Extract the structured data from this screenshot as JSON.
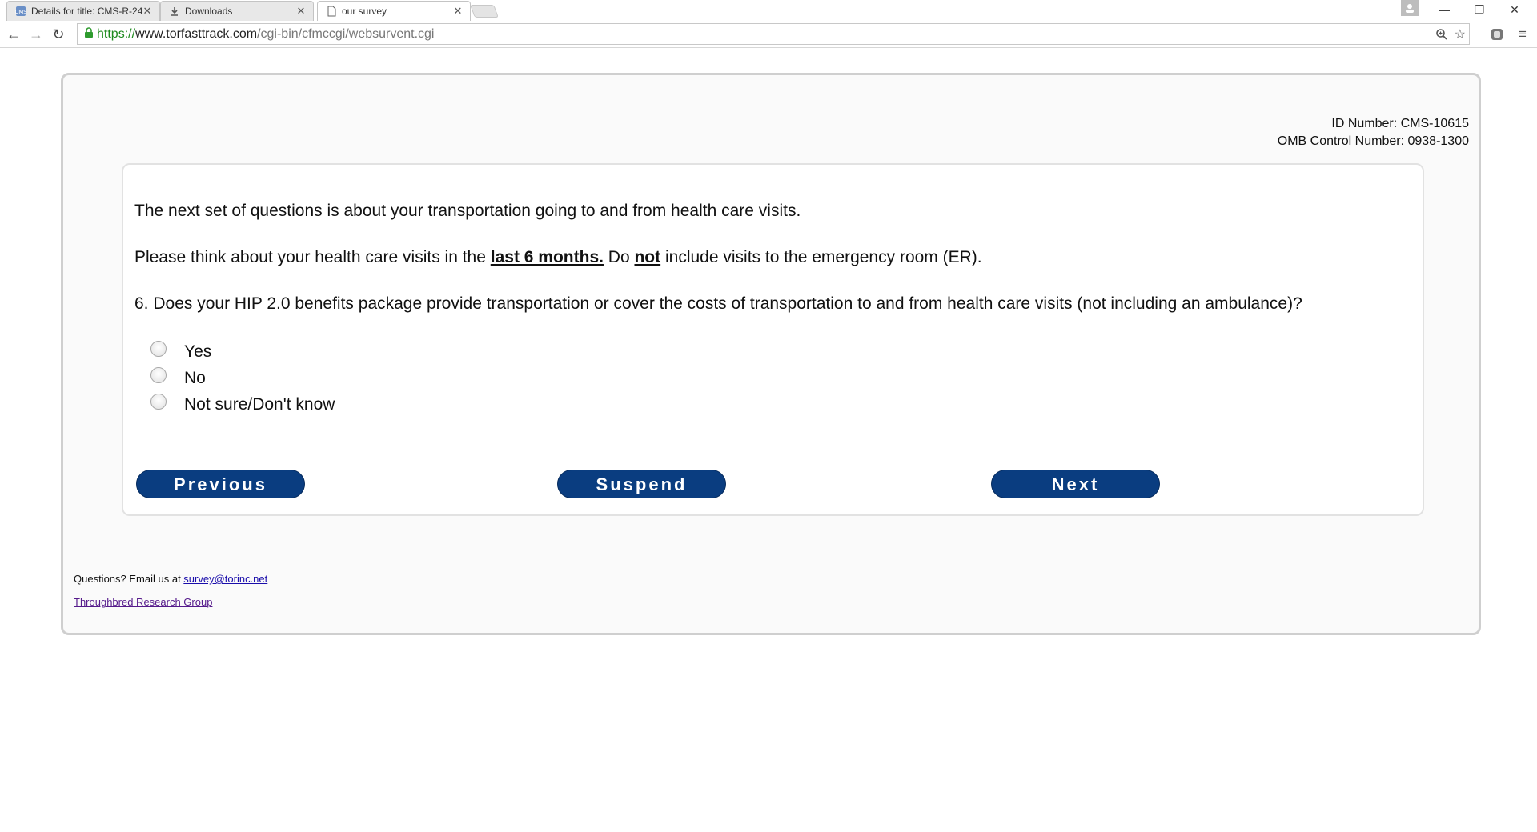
{
  "browser": {
    "tabs": [
      {
        "title": "Details for title: CMS-R-24",
        "favicon": "cms-favicon-icon"
      },
      {
        "title": "Downloads",
        "favicon": "download-icon"
      },
      {
        "title": "our survey",
        "favicon": "page-icon"
      }
    ],
    "url": {
      "scheme": "https://",
      "host": "www.torfasttrack.com",
      "path": "/cgi-bin/cfmccgi/websurvent.cgi"
    }
  },
  "survey": {
    "id_number": "ID Number: CMS-10615",
    "omb_number": "OMB Control Number: 0938-1300",
    "intro": "The next set of questions is about your transportation going to and from health care visits.",
    "instruction": {
      "part1": "Please think about your health care visits in the ",
      "emph1": "last 6 months.",
      "part2": " Do ",
      "emph2": "not",
      "part3": " include visits to the emergency room (ER)."
    },
    "question": "6. Does your HIP 2.0 benefits package provide transportation or cover the costs of transportation to and from health care visits (not including an ambulance)?",
    "options": [
      "Yes",
      "No",
      "Not sure/Don't know"
    ],
    "buttons": {
      "previous": "Previous",
      "suspend": "Suspend",
      "next": "Next"
    }
  },
  "footer": {
    "questions_prefix": "Questions? Email us at ",
    "email": "survey@torinc.net",
    "org_link": "Throughbred Research Group"
  }
}
